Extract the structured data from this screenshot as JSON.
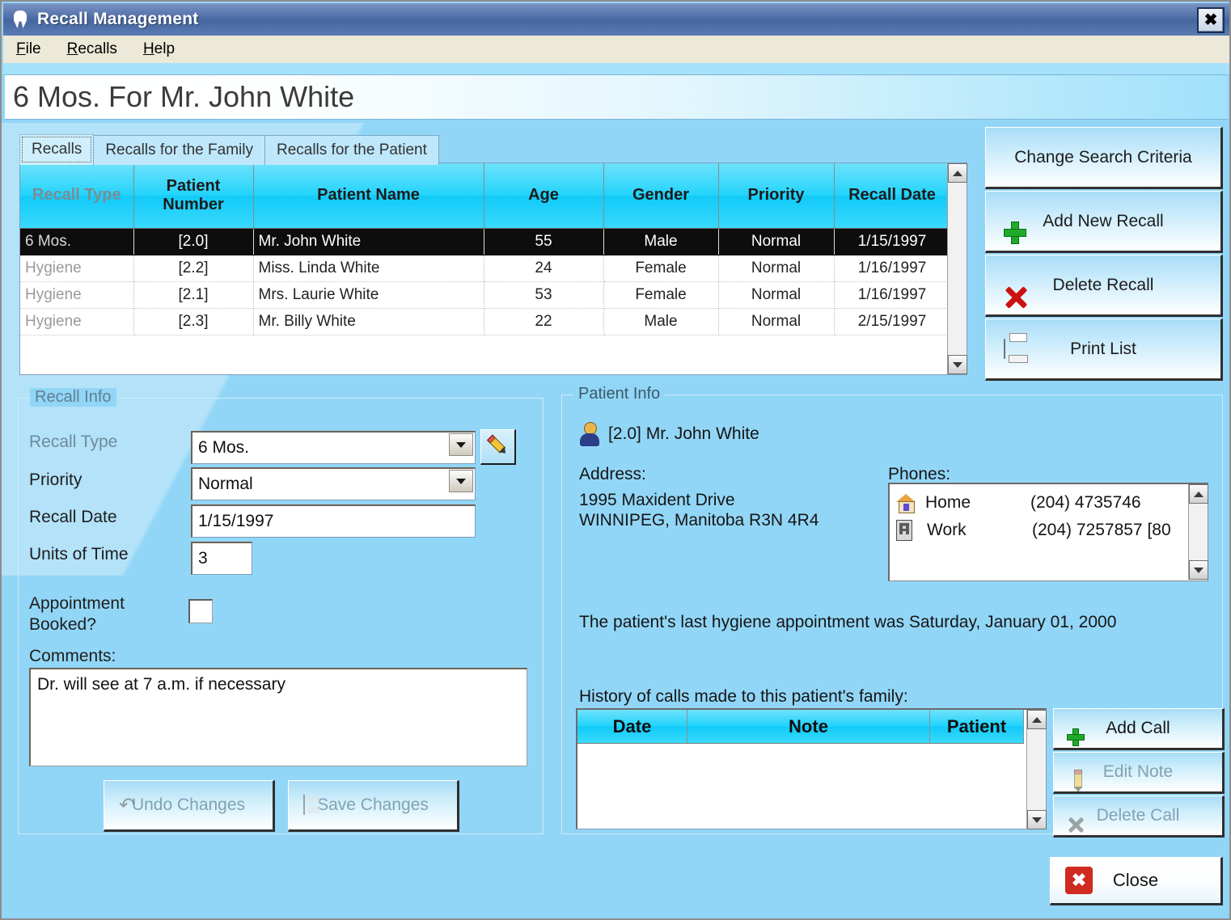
{
  "window": {
    "title": "Recall Management",
    "icon": "tooth-icon",
    "close_label": "✖"
  },
  "menu": {
    "items": [
      {
        "label": "File",
        "accel": "F"
      },
      {
        "label": "Recalls",
        "accel": "R"
      },
      {
        "label": "Help",
        "accel": "H"
      }
    ]
  },
  "headline": "6 Mos. For Mr. John White",
  "tabs": [
    {
      "label": "Recalls",
      "active": true
    },
    {
      "label": "Recalls for the Family",
      "active": false
    },
    {
      "label": "Recalls for the Patient",
      "active": false
    }
  ],
  "grid": {
    "columns": [
      "Recall Type",
      "Patient Number",
      "Patient Name",
      "Age",
      "Gender",
      "Priority",
      "Recall Date"
    ],
    "rows": [
      {
        "recall_type": "6 Mos.",
        "patient_number": "[2.0]",
        "patient_name": "Mr. John White",
        "age": "55",
        "gender": "Male",
        "priority": "Normal",
        "recall_date": "1/15/1997",
        "selected": true
      },
      {
        "recall_type": "Hygiene",
        "patient_number": "[2.2]",
        "patient_name": "Miss. Linda White",
        "age": "24",
        "gender": "Female",
        "priority": "Normal",
        "recall_date": "1/16/1997",
        "selected": false
      },
      {
        "recall_type": "Hygiene",
        "patient_number": "[2.1]",
        "patient_name": "Mrs. Laurie White",
        "age": "53",
        "gender": "Female",
        "priority": "Normal",
        "recall_date": "1/16/1997",
        "selected": false
      },
      {
        "recall_type": "Hygiene",
        "patient_number": "[2.3]",
        "patient_name": "Mr. Billy White",
        "age": "22",
        "gender": "Male",
        "priority": "Normal",
        "recall_date": "2/15/1997",
        "selected": false
      }
    ]
  },
  "actions": [
    {
      "label": "Change Search Criteria",
      "icon": "none"
    },
    {
      "label": "Add New Recall",
      "icon": "plus-icon"
    },
    {
      "label": "Delete Recall",
      "icon": "red-x-icon"
    },
    {
      "label": "Print List",
      "icon": "printer-icon"
    }
  ],
  "recall_info": {
    "title": "Recall Info",
    "recall_type_label": "Recall Type",
    "recall_type_value": "6 Mos.",
    "priority_label": "Priority",
    "priority_value": "Normal",
    "recall_date_label": "Recall Date",
    "recall_date_value": "1/15/1997",
    "units_label": "Units of Time",
    "units_value": "3",
    "appointment_label_1": "Appointment",
    "appointment_label_2": "Booked?",
    "appointment_checked": false,
    "comments_label": "Comments:",
    "comments_value": "Dr. will see at 7 a.m. if necessary",
    "undo_label": "Undo Changes",
    "save_label": "Save Changes"
  },
  "patient_info": {
    "title": "Patient Info",
    "patient_line": "[2.0] Mr. John White",
    "address_label": "Address:",
    "address_line1": "1995 Maxident Drive",
    "address_line2": "WINNIPEG, Manitoba  R3N 4R4",
    "phones_label": "Phones:",
    "phones": [
      {
        "type": "Home",
        "number": "(204) 4735746",
        "icon": "house-icon"
      },
      {
        "type": "Work",
        "number": "(204)  7257857 [80",
        "icon": "office-icon"
      }
    ],
    "last_hygiene_text": "The patient's last hygiene appointment was Saturday, January 01, 2000",
    "history_label": "History of calls made to this patient's family:",
    "history_columns": [
      "Date",
      "Note",
      "Patient"
    ],
    "history_rows": [],
    "call_buttons": [
      {
        "label": "Add Call",
        "icon": "plus-icon",
        "enabled": true
      },
      {
        "label": "Edit Note",
        "icon": "pencil-icon",
        "enabled": false
      },
      {
        "label": "Delete Call",
        "icon": "x-icon",
        "enabled": false
      }
    ]
  },
  "close_button": {
    "label": "Close",
    "icon": "red-close-icon",
    "glyph": "✖"
  },
  "colors": {
    "background": "#92d6f7",
    "header_cyan": "#12cbf8",
    "titlebar_blue": "#4e6da8",
    "menubar": "#ece9d8",
    "selected_row": "#0d0d0d",
    "accent_green": "#1faa2a",
    "accent_red": "#cc1111"
  }
}
